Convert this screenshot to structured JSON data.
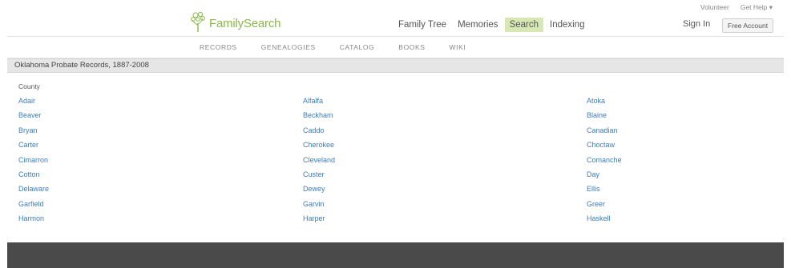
{
  "header": {
    "logo_text": "FamilySearch",
    "nav": [
      {
        "label": "Family Tree",
        "active": false
      },
      {
        "label": "Memories",
        "active": false
      },
      {
        "label": "Search",
        "active": true
      },
      {
        "label": "Indexing",
        "active": false
      }
    ],
    "util_links": [
      "Volunteer",
      "Get Help ▾"
    ],
    "sign_in": "Sign In",
    "free_account": "Free Account"
  },
  "subnav": [
    "RECORDS",
    "GENEALOGIES",
    "CATALOG",
    "BOOKS",
    "WIKI"
  ],
  "page_title": "Oklahoma Probate Records, 1887-2008",
  "county_heading": "County",
  "counties": {
    "col1": [
      "Adair",
      "Beaver",
      "Bryan",
      "Carter",
      "Cimarron",
      "Cotton",
      "Delaware",
      "Garfield",
      "Harmon"
    ],
    "col2": [
      "Alfalfa",
      "Beckham",
      "Caddo",
      "Cherokee",
      "Cleveland",
      "Custer",
      "Dewey",
      "Garvin",
      "Harper"
    ],
    "col3": [
      "Atoka",
      "Blaine",
      "Canadian",
      "Choctaw",
      "Comanche",
      "Day",
      "Ellis",
      "Greer",
      "Haskell"
    ]
  },
  "colors": {
    "link": "#3b7dbd",
    "active_nav_bg": "#d8e8b5",
    "logo_green": "#8bb84a",
    "footer_bg": "#4a4a4a"
  }
}
